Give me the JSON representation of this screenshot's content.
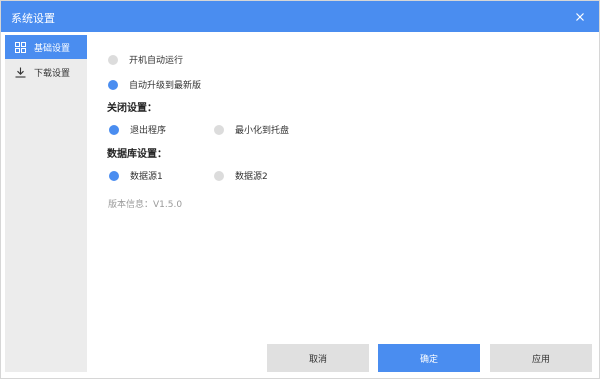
{
  "window": {
    "title": "系统设置",
    "close_icon": "close-icon"
  },
  "colors": {
    "accent": "#4a8df0",
    "sidebar_bg": "#ececec",
    "radio_off": "#dcdcdc"
  },
  "sidebar": {
    "items": [
      {
        "label": "基础设置",
        "icon": "grid-icon",
        "active": true
      },
      {
        "label": "下载设置",
        "icon": "download-icon",
        "active": false
      }
    ]
  },
  "basic": {
    "auto_start": {
      "label": "开机自动运行",
      "checked": false
    },
    "auto_upgrade": {
      "label": "自动升级到最新版",
      "checked": true
    }
  },
  "close_settings": {
    "title": "关闭设置：",
    "options": [
      {
        "label": "退出程序",
        "checked": true
      },
      {
        "label": "最小化到托盘",
        "checked": false
      }
    ]
  },
  "database_settings": {
    "title": "数据库设置：",
    "options": [
      {
        "label": "数据源1",
        "checked": true
      },
      {
        "label": "数据源2",
        "checked": false
      }
    ]
  },
  "version": "版本信息：V1.5.0",
  "buttons": {
    "cancel": "取消",
    "confirm": "确定",
    "apply": "应用"
  }
}
